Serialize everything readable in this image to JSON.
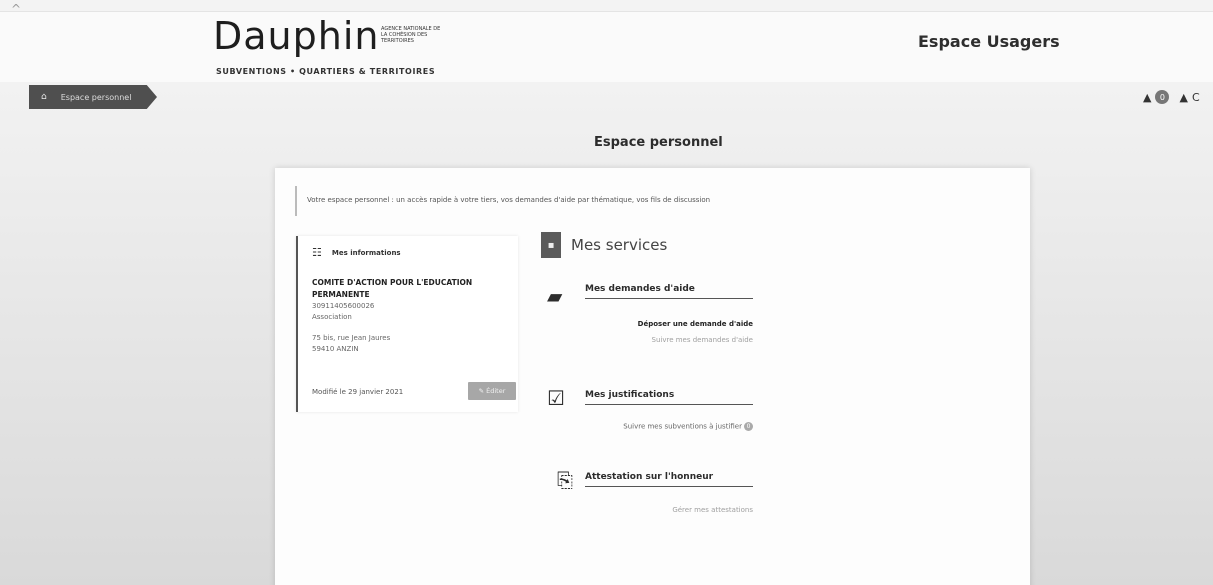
{
  "header": {
    "logo_word": "Dauphin",
    "logo_agency": "AGENCE NATIONALE DE LA COHÉSION DES TERRITOIRES",
    "logo_sub": "SUBVENTIONS • QUARTIERS & TERRITOIRES",
    "portal_title": "Espace Usagers"
  },
  "breadcrumb": {
    "label": "Espace personnel"
  },
  "user_menu": {
    "badge": "0",
    "label": "C"
  },
  "page": {
    "title": "Espace personnel",
    "intro": "Votre espace personnel : un accès rapide à votre tiers, vos demandes d'aide par thématique, vos fils de discussion"
  },
  "info": {
    "heading": "Mes informations",
    "org_name": "COMITE D'ACTION POUR L'EDUCATION PERMANENTE",
    "siret": "30911405600026",
    "type": "Association",
    "address_line": "75 bis, rue Jean Jaures",
    "city": "59410 ANZIN",
    "modified": "Modifié le 29 janvier 2021",
    "edit_label": "Éditer"
  },
  "services": {
    "title": "Mes services",
    "items": [
      {
        "title": "Mes demandes d'aide",
        "icon": "folder-icon",
        "links": [
          "Déposer une demande d'aide",
          "Suivre mes demandes d'aide"
        ]
      },
      {
        "title": "Mes justifications",
        "icon": "checkbox-icon",
        "links": [
          "Suivre mes subventions à justifier"
        ],
        "badge": "0"
      },
      {
        "title": "Attestation sur l'honneur",
        "icon": "attestation-icon",
        "links": [
          "Gérer mes attestations"
        ]
      }
    ]
  }
}
